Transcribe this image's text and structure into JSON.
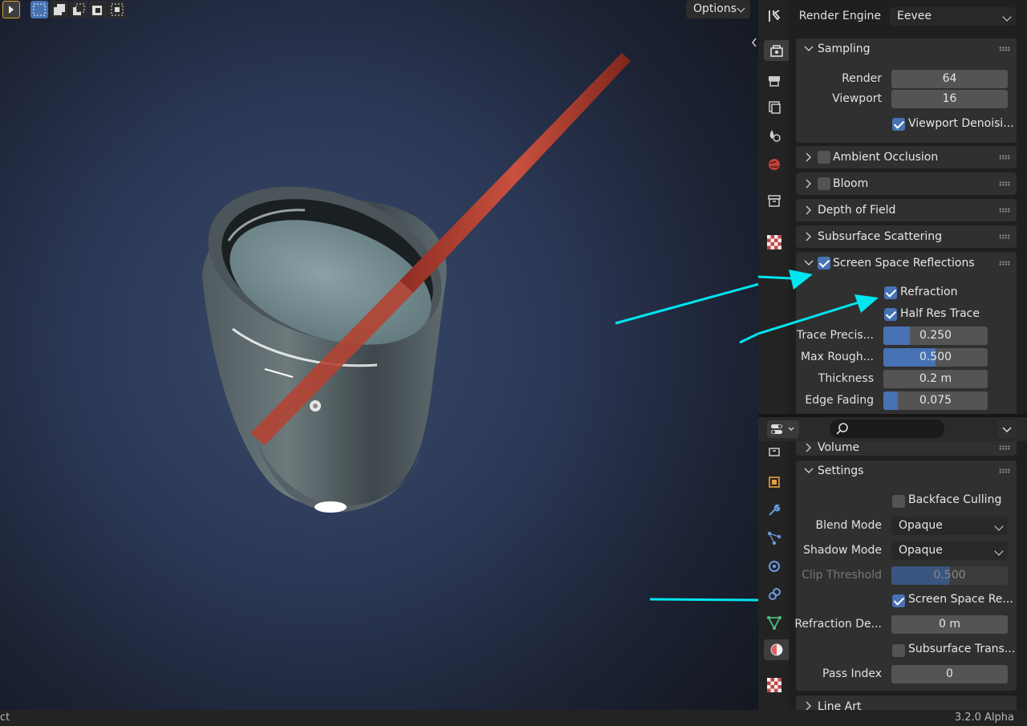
{
  "viewport": {
    "options_label": "Options",
    "background_colors": {
      "center": "#3a4a6c",
      "edge": "#141820"
    }
  },
  "render_props": {
    "render_engine_label": "Render Engine",
    "render_engine_value": "Eevee",
    "sampling": {
      "title": "Sampling",
      "render_label": "Render",
      "render_value": "64",
      "viewport_label": "Viewport",
      "viewport_value": "16",
      "denoise_label": "Viewport Denoisi..."
    },
    "panels": {
      "ambient_occlusion": "Ambient Occlusion",
      "bloom": "Bloom",
      "depth_of_field": "Depth of Field",
      "subsurface_scattering": "Subsurface Scattering"
    },
    "ssr": {
      "title": "Screen Space Reflections",
      "refraction_label": "Refraction",
      "half_res_label": "Half Res Trace",
      "trace_precision_label": "Trace Precis...",
      "trace_precision_value": "0.250",
      "trace_precision_fill": 0.25,
      "max_roughness_label": "Max Rough...",
      "max_roughness_value": "0.500",
      "max_roughness_fill": 0.5,
      "thickness_label": "Thickness",
      "thickness_value": "0.2 m",
      "edge_fading_label": "Edge Fading",
      "edge_fading_value": "0.075",
      "edge_fading_fill": 0.14
    }
  },
  "material_props": {
    "volume_title": "Volume",
    "settings_title": "Settings",
    "backface_culling_label": "Backface Culling",
    "blend_mode_label": "Blend Mode",
    "blend_mode_value": "Opaque",
    "shadow_mode_label": "Shadow Mode",
    "shadow_mode_value": "Opaque",
    "clip_threshold_label": "Clip Threshold",
    "clip_threshold_value": "0.500",
    "clip_threshold_fill": 0.5,
    "ssr_label": "Screen Space Re...",
    "refraction_depth_label": "Refraction De...",
    "refraction_depth_value": "0 m",
    "subsurface_trans_label": "Subsurface Trans...",
    "pass_index_label": "Pass Index",
    "pass_index_value": "0",
    "line_art_title": "Line Art"
  },
  "status": {
    "left_text": "ct",
    "version": "3.2.0 Alpha"
  },
  "colors": {
    "accent": "#4772b3",
    "annotation_arrow": "#00e5f0",
    "straw": "#c0473a"
  }
}
